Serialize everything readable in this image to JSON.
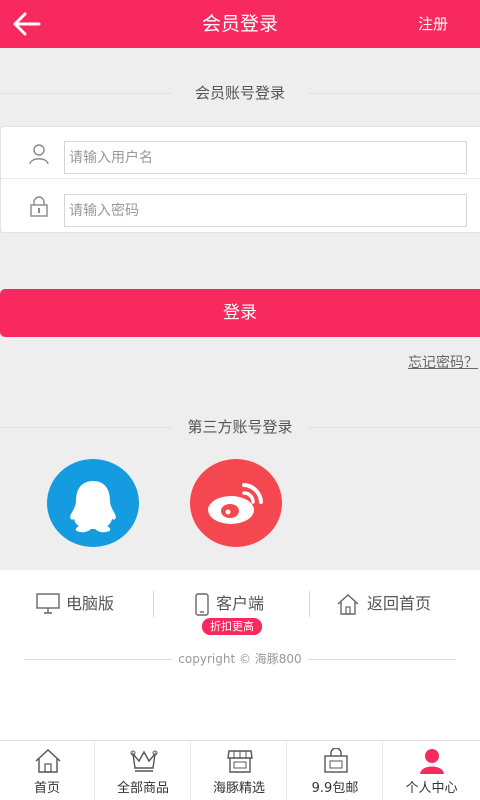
{
  "header": {
    "title": "会员登录",
    "register_label": "注册"
  },
  "login": {
    "section_title": "会员账号登录",
    "username_placeholder": "请输入用户名",
    "password_placeholder": "请输入密码",
    "login_button": "登录",
    "forgot_label": "忘记密码？"
  },
  "third_party": {
    "section_title": "第三方账号登录",
    "providers": [
      "qq-icon",
      "weibo-icon"
    ]
  },
  "links": {
    "pc": "电脑版",
    "client": "客户端",
    "client_badge": "折扣更高",
    "home": "返回首页"
  },
  "copyright": "copyright © 海豚800",
  "tabbar": {
    "items": [
      {
        "label": "首页",
        "icon": "home-icon"
      },
      {
        "label": "全部商品",
        "icon": "crown-icon"
      },
      {
        "label": "海豚精选",
        "icon": "shop-icon"
      },
      {
        "label": "9.9包邮",
        "icon": "bag-icon"
      },
      {
        "label": "个人中心",
        "icon": "user-icon"
      }
    ]
  },
  "colors": {
    "accent": "#f7295f",
    "qq": "#159be0",
    "weibo": "#f5474f"
  }
}
